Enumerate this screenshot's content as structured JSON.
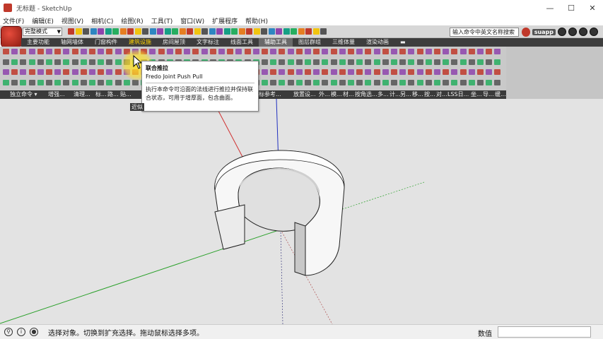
{
  "window": {
    "title": "无标题 - SketchUp",
    "controls": [
      "—",
      "☐",
      "✕"
    ]
  },
  "menu": [
    "文件(F)",
    "编辑(E)",
    "视图(V)",
    "相机(C)",
    "绘图(R)",
    "工具(T)",
    "窗口(W)",
    "扩展程序",
    "帮助(H)"
  ],
  "toolbar": {
    "mode_select": "完整模式",
    "search_placeholder": "输入命令中英文名称搜索",
    "suapp_label": "suapp"
  },
  "tabs": [
    "主要功能",
    "轴网墙体",
    "门窗构件",
    "建筑设施",
    "房间屋顶",
    "文字标注",
    "线面工具",
    "辅助工具",
    "图层群组",
    "三维体量",
    "渲染动画"
  ],
  "active_tab": "辅助工具",
  "hover_tab": "建筑设施",
  "group_labels": [
    "独立命令 ▾",
    "增强...",
    "清理...",
    "标...",
    "路...",
    "贴...",
    "标参考...",
    "放置设...",
    "外...",
    "模...",
    "材...",
    "按角选...",
    "多...",
    "计...",
    "另...",
    "移...",
    "按...",
    "对...",
    "LSS日...",
    "坐...",
    "导...",
    "缓..."
  ],
  "partial_label": "近似",
  "tooltip": {
    "title": "联合推拉",
    "subtitle": "Fredo Joint Push Pull",
    "description": "执行本命令可沿面的法线进行推拉并保持联合状态，可用于增厚面，包含曲面。"
  },
  "statusbar": {
    "message": "选择对象。切换到扩充选择。拖动鼠标选择多项。",
    "value_label": "数值",
    "value": ""
  },
  "colors": {
    "brand": "#c0392b",
    "tab_bar": "#3d3d3d",
    "viewport": "#e3e3e3",
    "highlight": "#ffd400"
  }
}
